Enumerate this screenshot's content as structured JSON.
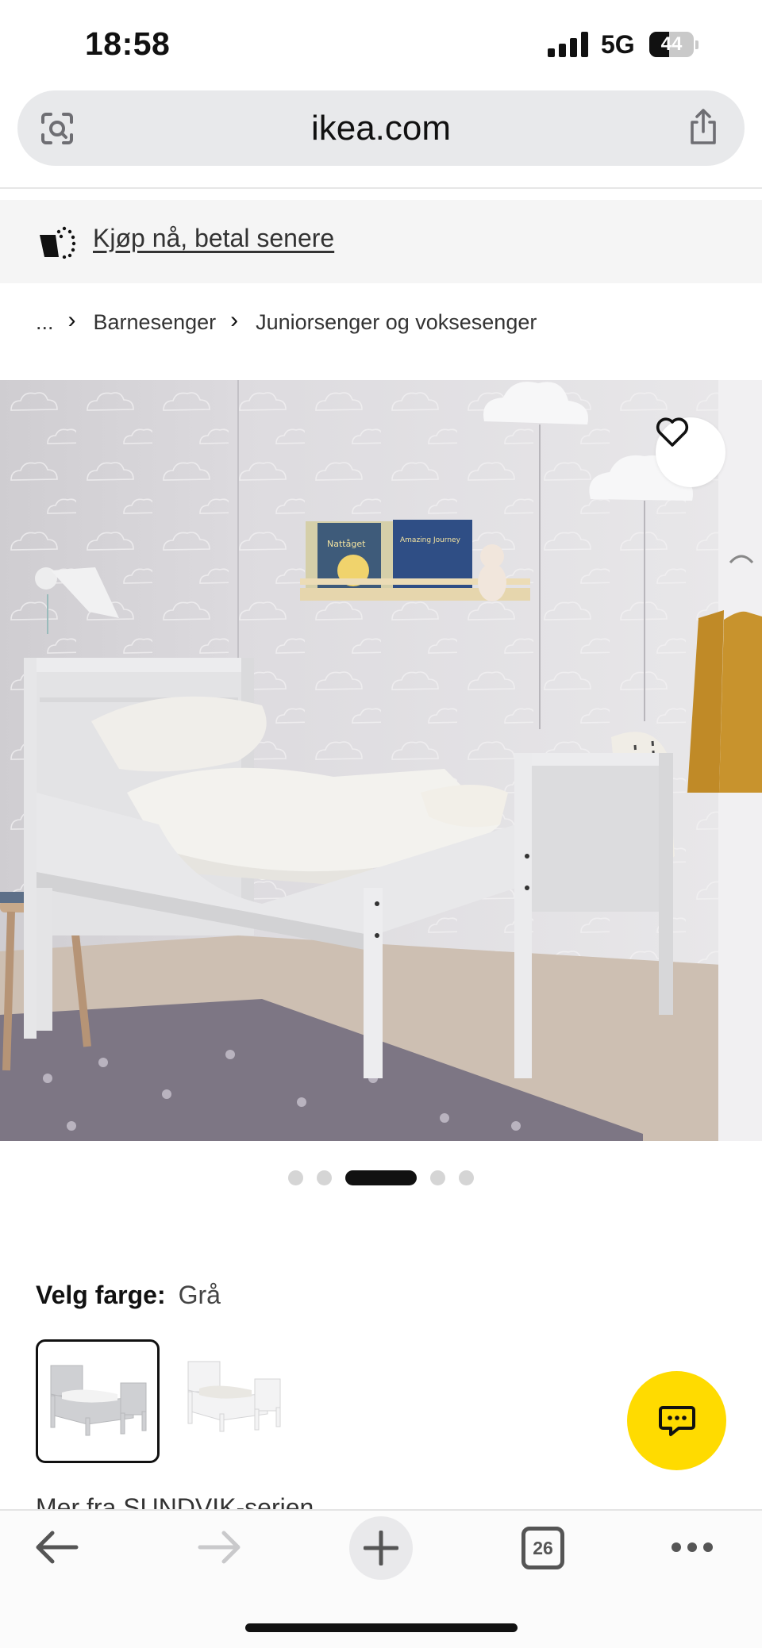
{
  "status_bar": {
    "time": "18:58",
    "network": "5G",
    "battery": "44",
    "battery_level": 0.44
  },
  "url_bar": {
    "domain": "ikea.com",
    "icons": [
      "scan-icon",
      "share-icon"
    ]
  },
  "banner": {
    "link_text": "Kjøp nå, betal senere",
    "icon": "cart-icon"
  },
  "breadcrumb": {
    "items": [
      "...",
      "Barnesenger",
      "Juniorsenger og voksesenger"
    ]
  },
  "gallery": {
    "slide_count": 5,
    "active_index": 2,
    "image_text": {
      "book_1": "Nattåget",
      "book_2": "Amazing Journey"
    }
  },
  "color_picker": {
    "label": "Velg farge:",
    "value": "Grå",
    "options": [
      "Grå",
      "Hvit"
    ],
    "selected_index": 0
  },
  "more_series": "Mer fra SUNDVIK-serien",
  "toolbar": {
    "tabs_count": "26",
    "icons": [
      "back-icon",
      "forward-icon",
      "plus-icon",
      "tabs-icon",
      "more-icon"
    ]
  },
  "colors": {
    "accent_yellow": "#ffdb00",
    "text": "#111111",
    "banner_bg": "#f5f5f5"
  }
}
